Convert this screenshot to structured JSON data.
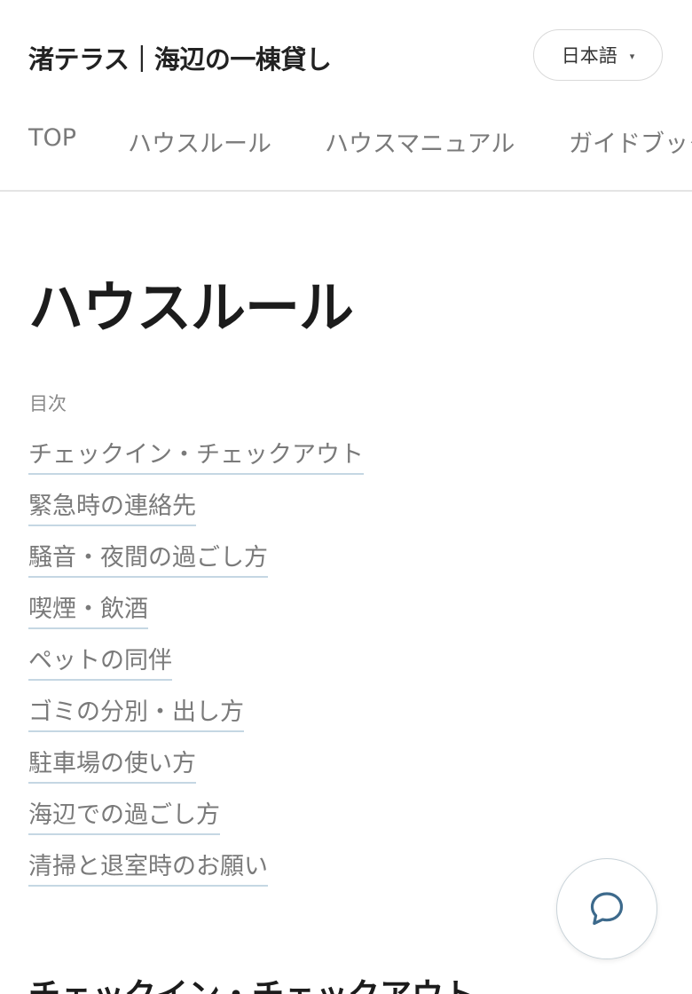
{
  "header": {
    "site_title": "渚テラス｜海辺の一棟貸し",
    "language": {
      "selected": "日本語",
      "caret": "▾"
    }
  },
  "nav": {
    "items": [
      {
        "label": "TOP"
      },
      {
        "label": "ハウスルール"
      },
      {
        "label": "ハウスマニュアル"
      },
      {
        "label": "ガイドブック"
      }
    ]
  },
  "main": {
    "title": "ハウスルール",
    "toc": {
      "heading": "目次",
      "items": [
        {
          "label": "チェックイン・チェックアウト"
        },
        {
          "label": "緊急時の連絡先"
        },
        {
          "label": "騒音・夜間の過ごし方"
        },
        {
          "label": "喫煙・飲酒"
        },
        {
          "label": "ペットの同伴"
        },
        {
          "label": "ゴミの分別・出し方"
        },
        {
          "label": "駐車場の使い方"
        },
        {
          "label": "海辺での過ごし方"
        },
        {
          "label": "清掃と退室時のお願い"
        }
      ]
    },
    "section_title": "チェックイン・チェックアウト"
  },
  "chat": {
    "icon": "chat-bubble-icon",
    "color": "#3d6a8c"
  },
  "colors": {
    "link_underline": "#c5d7e3",
    "muted_text": "#7a7a7a"
  }
}
